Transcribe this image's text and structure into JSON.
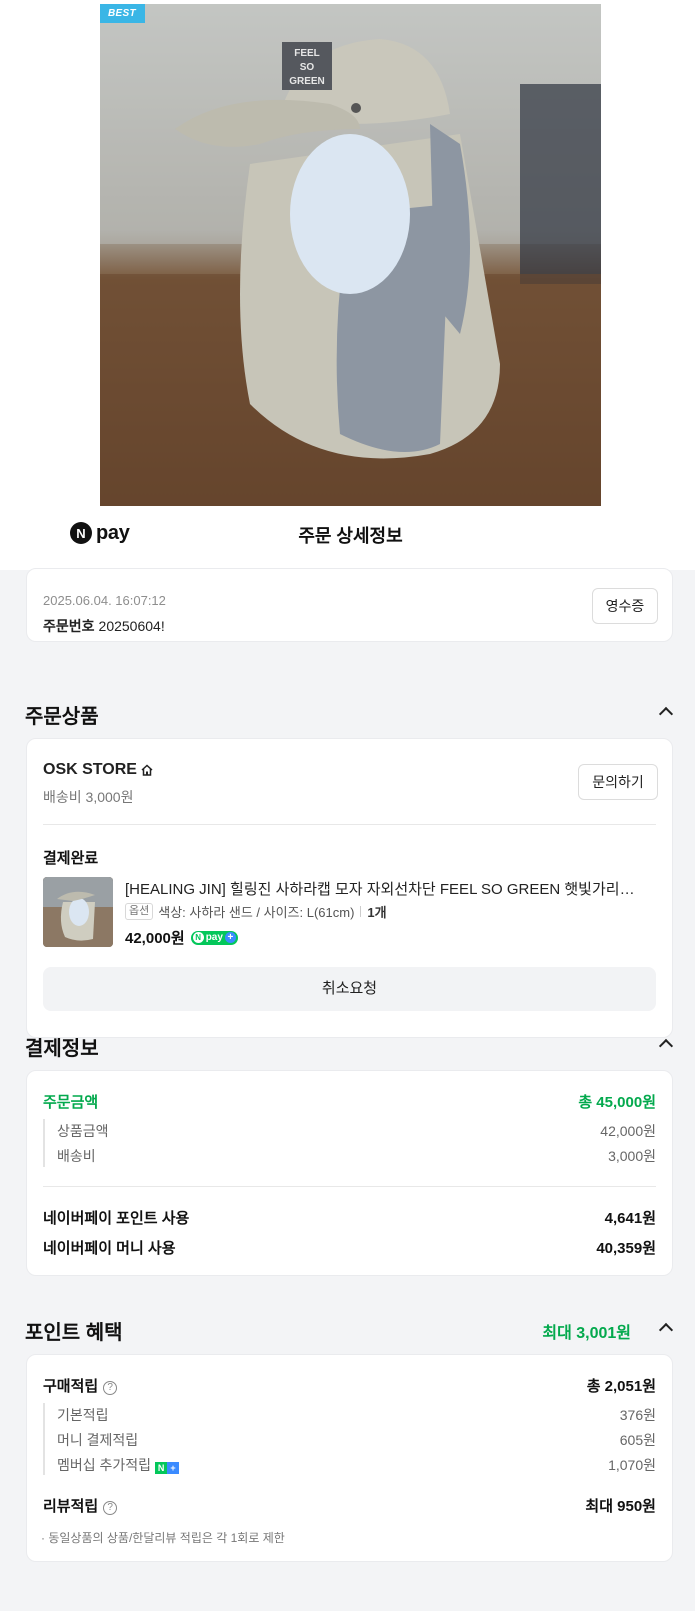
{
  "hero": {
    "badge": "BEST",
    "cap_text": "FEEL SO GREEN"
  },
  "header": {
    "logo_n": "N",
    "logo_text": "pay",
    "title": "주문 상세정보"
  },
  "order": {
    "date": "2025.06.04. 16:07:12",
    "number_label": "주문번호",
    "number_value": "20250604!",
    "receipt_button": "영수증"
  },
  "products": {
    "title": "주문상품",
    "store_name": "OSK STORE",
    "shipping_fee": "배송비 3,000원",
    "inquiry_button": "문의하기",
    "status": "결제완료",
    "item": {
      "name": "[HEALING JIN] 힐링진 사하라캡 모자 자외선차단 FEEL SO GREEN 햇빛가리개 플랩캡",
      "option_tag": "옵션",
      "option_text": "색상: 사하라 샌드 / 사이즈: L(61cm)",
      "quantity": "1개",
      "price": "42,000원",
      "npay_badge": "pay"
    },
    "cancel_button": "취소요청"
  },
  "payment": {
    "title": "결제정보",
    "order_amount_label": "주문금액",
    "order_amount_value": "총 45,000원",
    "product_amount_label": "상품금액",
    "product_amount_value": "42,000원",
    "shipping_label": "배송비",
    "shipping_value": "3,000원",
    "point_use_label": "네이버페이 포인트 사용",
    "point_use_value": "4,641원",
    "money_use_label": "네이버페이 머니 사용",
    "money_use_value": "40,359원"
  },
  "points": {
    "title": "포인트 혜택",
    "max_label": "최대 3,001원",
    "purchase_label": "구매적립",
    "purchase_value": "총 2,051원",
    "basic_label": "기본적립",
    "basic_value": "376원",
    "money_label": "머니 결제적립",
    "money_value": "605원",
    "membership_label": "멤버십 추가적립",
    "membership_value": "1,070원",
    "review_label": "리뷰적립",
    "review_value": "최대 950원",
    "note": "· 동일상품의 상품/한달리뷰 적립은 각 1회로 제한"
  },
  "colors": {
    "accent_green": "#03a94d",
    "badge_blue": "#3ab6e6",
    "page_gray": "#f3f4f6"
  }
}
